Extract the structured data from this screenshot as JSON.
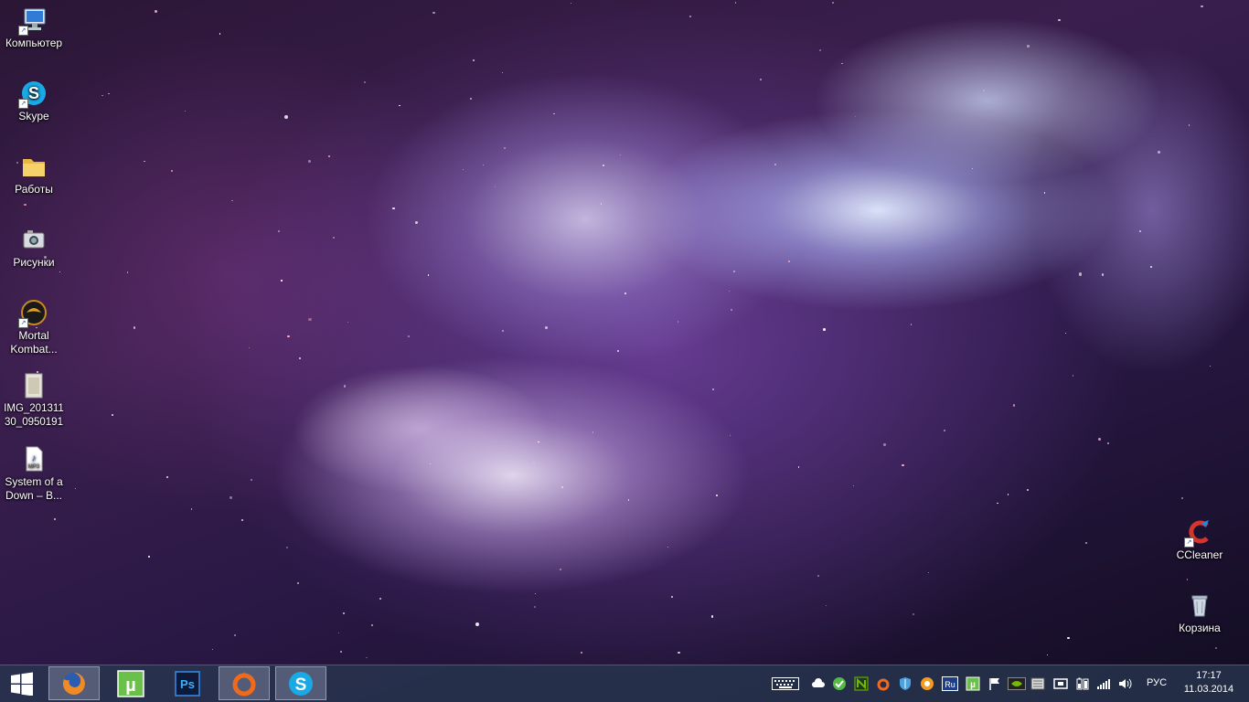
{
  "desktop": {
    "icons": [
      {
        "label": "Компьютер",
        "icon": "computer-icon"
      },
      {
        "label": "Skype",
        "icon": "skype-icon"
      },
      {
        "label": "Работы",
        "icon": "folder-icon"
      },
      {
        "label": "Рисунки",
        "icon": "pictures-camera-icon"
      },
      {
        "label": "Mortal Kombat...",
        "icon": "mortal-kombat-icon"
      },
      {
        "label": "IMG_20131130_0950191",
        "icon": "image-file-icon"
      },
      {
        "label": "System of a Down – B...",
        "icon": "mp3-file-icon"
      },
      {
        "label": "CCleaner",
        "icon": "ccleaner-icon"
      },
      {
        "label": "Корзина",
        "icon": "recycle-bin-icon"
      }
    ]
  },
  "taskbar": {
    "pinned_apps": [
      {
        "name": "Firefox",
        "icon": "firefox-icon",
        "active": true
      },
      {
        "name": "uTorrent",
        "icon": "utorrent-icon",
        "active": false
      },
      {
        "name": "Photoshop",
        "icon": "photoshop-icon",
        "active": false
      },
      {
        "name": "Origin",
        "icon": "origin-icon",
        "active": true
      },
      {
        "name": "Skype",
        "icon": "skype-icon",
        "active": true
      }
    ],
    "tray_icons": [
      "keyboard-icon",
      "cloud-icon",
      "shield-green-icon",
      "nvidia-tray-icon",
      "origin-tray-icon",
      "defender-icon",
      "avast-icon",
      "ru-icon",
      "utorrent-tray-icon",
      "flag-icon",
      "nvidia-icon",
      "device-icon",
      "network-adapter-icon",
      "battery-icon",
      "signal-icon",
      "volume-icon"
    ],
    "language": "РУС",
    "time": "17:17",
    "date": "11.03.2014"
  },
  "colors": {
    "taskbar": "#28374f",
    "accent": "#3a7bd5"
  }
}
